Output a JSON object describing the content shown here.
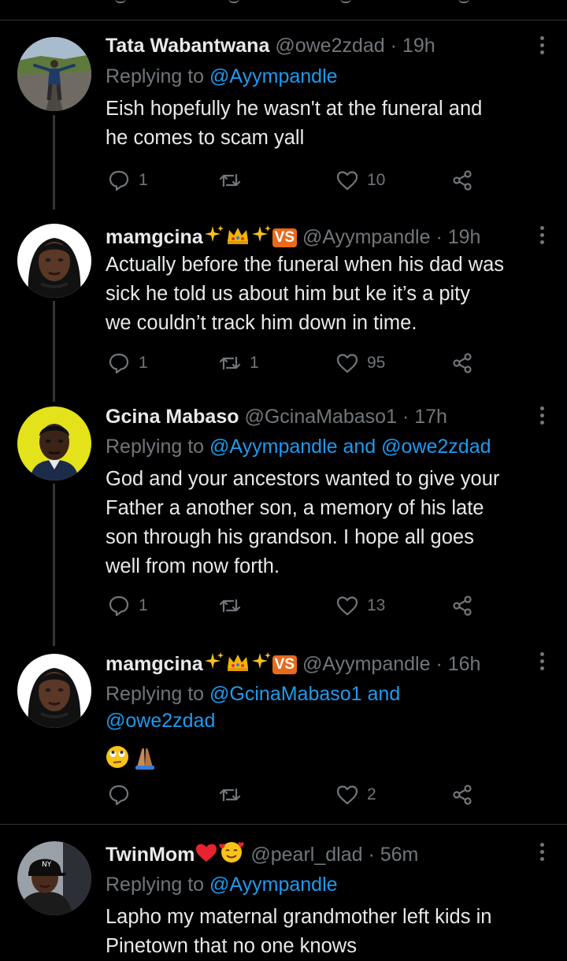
{
  "tweets": [
    {
      "name": "Tata Wabantwana",
      "handle": "@owe2zdad",
      "time": "· 19h",
      "replying_prefix": "Replying to",
      "replying_to": "@Ayympandle",
      "replying_and": "",
      "replying_to2": "",
      "body": [
        "Eish hopefully he wasn't at the funeral and",
        "he comes to scam yall"
      ],
      "replies": "1",
      "retweets": "",
      "likes": "10"
    },
    {
      "name": "mamgcina",
      "handle": "@Ayympandle",
      "time": "· 19h",
      "badge_vs": "VS",
      "body": [
        "Actually before the funeral when his dad was",
        "sick he told us about him but ke it’s a pity",
        "we couldn’t track him down in time."
      ],
      "replies": "1",
      "retweets": "1",
      "likes": "95"
    },
    {
      "name": "Gcina Mabaso",
      "handle": "@GcinaMabaso1",
      "time": "· 17h",
      "replying_prefix": "Replying to",
      "replying_to": "@Ayympandle",
      "replying_and": "and",
      "replying_to2": "@owe2zdad",
      "body": [
        "God and your ancestors wanted to give your",
        "Father a another son, a memory of his late",
        "son through his grandson. I hope all goes",
        "well from now forth."
      ],
      "replies": "1",
      "retweets": "",
      "likes": "13"
    },
    {
      "name": "mamgcina",
      "handle": "@Ayympandle",
      "time": "· 16h",
      "badge_vs": "VS",
      "replying_prefix": "Replying to",
      "replying_to": "@GcinaMabaso1",
      "replying_and": "and",
      "replying_to2": "@owe2zdad",
      "body_emoji": "rolling-eyes-and-praying-hands",
      "replies": "",
      "retweets": "",
      "likes": "2"
    },
    {
      "name": "TwinMom",
      "handle": "@pearl_dlad",
      "time": "· 56m",
      "replying_prefix": "Replying to",
      "replying_to": "@Ayympandle",
      "body": [
        "Lapho my maternal grandmother left kids in",
        "Pinetown that no one knows"
      ]
    }
  ],
  "colors": {
    "background": "#000000",
    "text": "#e7e9ea",
    "muted": "#71767b",
    "link": "#1d9bf0",
    "thread_line": "#333639"
  }
}
